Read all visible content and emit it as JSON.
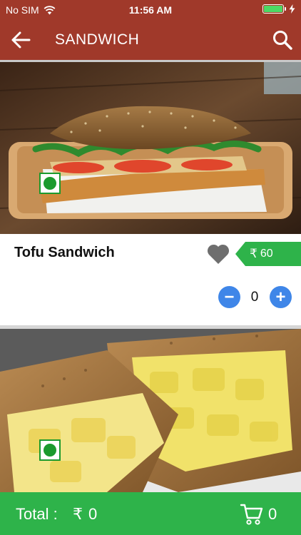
{
  "status_bar": {
    "carrier": "No SIM",
    "time": "11:56 AM",
    "battery_level": 1.0
  },
  "header": {
    "title": "SANDWICH",
    "back_icon": "arrow-left-icon",
    "search_icon": "search-icon"
  },
  "items": [
    {
      "name": "Tofu Sandwich",
      "currency": "₹",
      "price": "60",
      "quantity": "0",
      "veg_icon": "veg-indicator-icon",
      "favorite_icon": "heart-icon",
      "decrement_label": "−",
      "increment_label": "+"
    },
    {
      "veg_icon": "veg-indicator-icon"
    }
  ],
  "footer": {
    "total_label": "Total :",
    "currency": "₹",
    "total_value": "0",
    "cart_icon": "cart-icon",
    "cart_count": "0"
  },
  "colors": {
    "header": "#a0392a",
    "accent_green": "#2eb34a",
    "stepper_blue": "#3f86e8",
    "veg_green": "#1b9a2e"
  }
}
